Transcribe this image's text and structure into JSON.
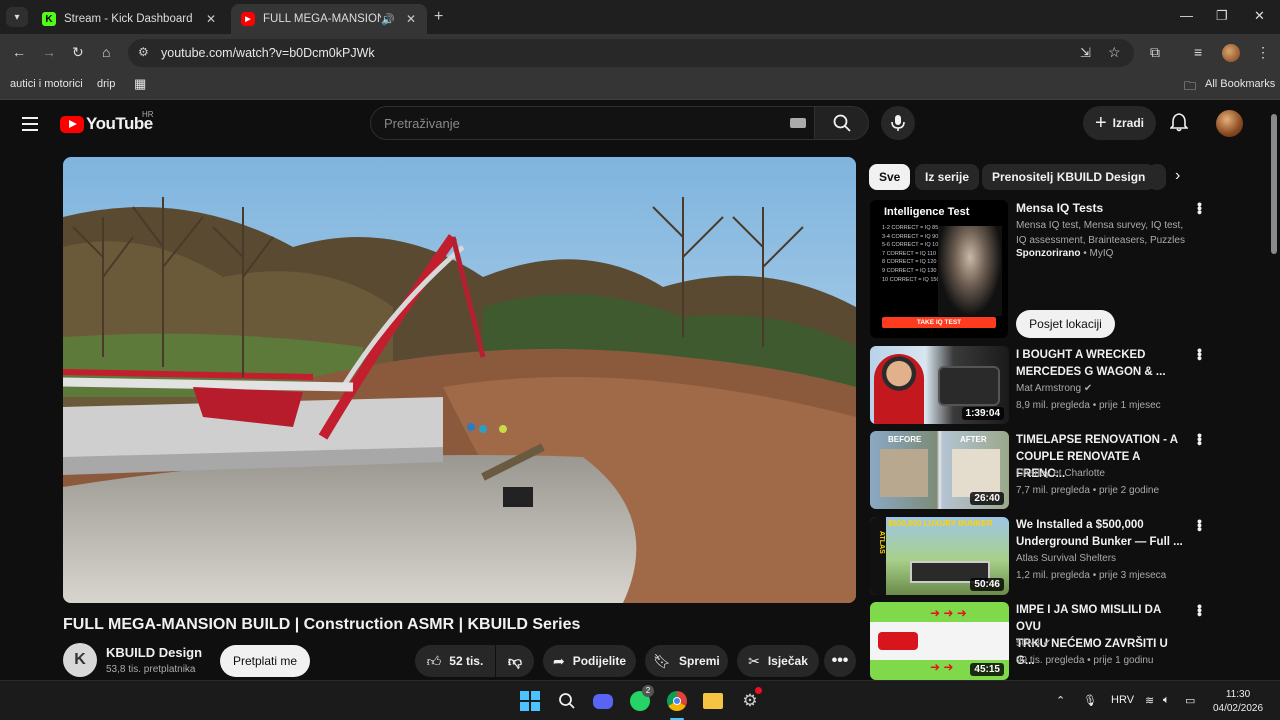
{
  "browser": {
    "tabs": [
      {
        "title": "Stream - Kick Dashboard",
        "active": false
      },
      {
        "title": "FULL MEGA-MANSION BUIL",
        "active": true
      }
    ],
    "url": "youtube.com/watch?v=b0Dcm0kPJWk",
    "bookmarks": [
      "autici i motorici",
      "drip"
    ],
    "all_bookmarks": "All Bookmarks"
  },
  "youtube": {
    "logo_text": "YouTube",
    "region": "HR",
    "search_placeholder": "Pretraživanje",
    "create_label": "Izradi"
  },
  "video": {
    "title": "FULL MEGA-MANSION BUILD | Construction ASMR | KBUILD Series",
    "channel": "KBUILD Design",
    "subscribers": "53,8 tis. pretplatnika",
    "subscribe_label": "Pretplati me",
    "likes": "52 tis.",
    "share_label": "Podijelite",
    "save_label": "Spremi",
    "clip_label": "Isječak"
  },
  "chips": [
    "Sve",
    "Iz serije",
    "Prenositelj KBUILD Design"
  ],
  "ad": {
    "thumb_heading": "Intelligence Test",
    "thumb_rows": [
      "1-2 CORRECT = IQ 85",
      "3-4 CORRECT = IQ 90",
      "5-6 CORRECT = IQ 100",
      "7 CORRECT = IQ 110",
      "8 CORRECT = IQ 120",
      "9 CORRECT = IQ 130",
      "10 CORRECT = IQ 150"
    ],
    "thumb_cta": "TAKE IQ TEST",
    "title": "Mensa IQ Tests",
    "description": "Mensa IQ test, Mensa survey, IQ test, IQ assessment, Brainteasers, Puzzles",
    "sponsored": "Sponzorirano",
    "advertiser": "MyIQ",
    "visit_label": "Posjet lokaciji"
  },
  "recommendations": [
    {
      "title_line1": "I BOUGHT A WRECKED",
      "title_line2": "MERCEDES G WAGON & ...",
      "channel": "Mat Armstrong",
      "verified": true,
      "meta": "8,9 mil. pregleda • prije 1 mjesec",
      "duration": "1:39:04"
    },
    {
      "title_line1": "TIMELAPSE  RENOVATION - A",
      "title_line2": "COUPLE RENOVATE A FRENC...",
      "channel": "Charley et Charlotte",
      "verified": false,
      "meta": "7,7 mil. pregleda • prije 2 godine",
      "duration": "26:40",
      "before": "BEFORE",
      "after": "AFTER"
    },
    {
      "title_line1": "We Installed a $500,000",
      "title_line2": "Underground Bunker — Full ...",
      "channel": "Atlas Survival Shelters",
      "verified": false,
      "meta": "1,2 mil. pregleda • prije 3 mjeseca",
      "duration": "50:46",
      "thumb_text": "$500,000 LUXURY BUNKER",
      "side_text": "ATLAS"
    },
    {
      "title_line1": "IMPE I JA SMO MISLILI DA OVU",
      "title_line2": "TRKU NEĆEMO ZAVRŠITI U G...",
      "channel": "50N3",
      "verified": true,
      "meta": "99 tis. pregleda • prije 1 godinu",
      "duration": "45:15"
    }
  ],
  "taskbar": {
    "language": "HRV",
    "time": "11:30",
    "date": "04/02/2026",
    "whatsapp_badge": "2"
  }
}
